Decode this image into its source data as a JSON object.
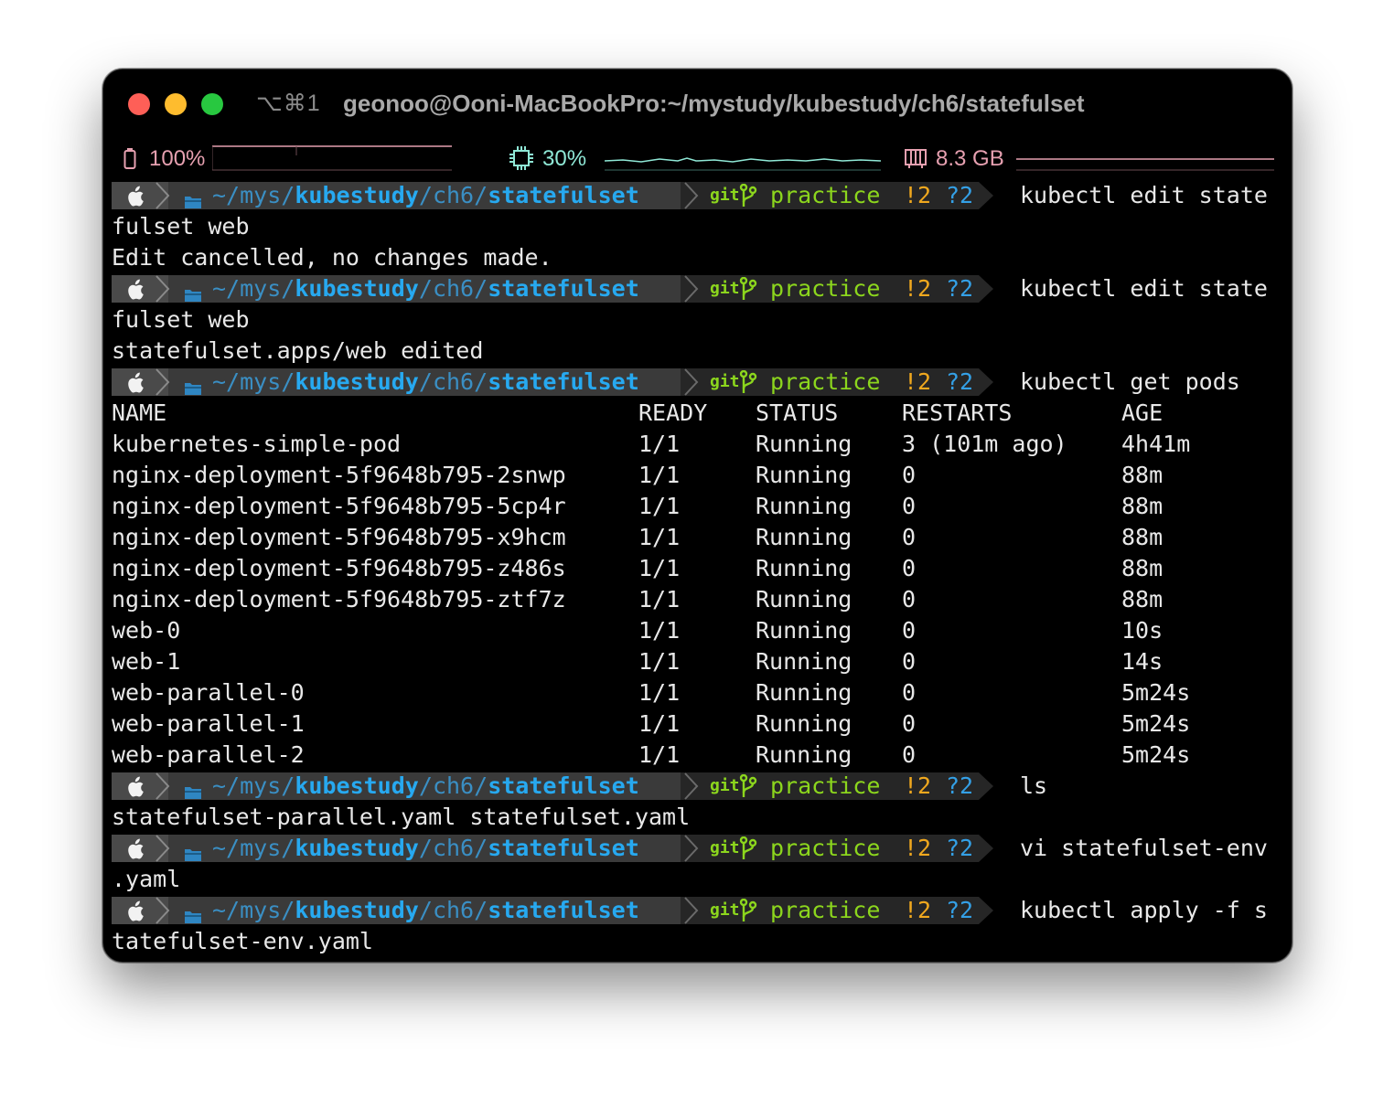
{
  "window": {
    "shortcut": "⌥⌘1",
    "title": "geonoo@Ooni-MacBookPro:~/mystudy/kubestudy/ch6/statefulset"
  },
  "status_bar": {
    "battery": "100%",
    "cpu": "30%",
    "memory": "8.3 GB",
    "colors": {
      "battery": "#e6a0b0",
      "cpu": "#8fe8d6",
      "memory": "#e6a0b0"
    }
  },
  "prompt": {
    "path_home": "~/",
    "path_mys": "mys/",
    "path_kubestudy": "kubestudy",
    "path_ch6": "/ch6/",
    "path_statefulset": "statefulset",
    "git_label": "git",
    "branch": "practice",
    "modified": "!2",
    "untracked": "?2"
  },
  "session": [
    {
      "command": "kubectl edit state",
      "output": [
        "fulset web",
        "Edit cancelled, no changes made."
      ]
    },
    {
      "command": "kubectl edit state",
      "output": [
        "fulset web",
        "statefulset.apps/web edited"
      ]
    },
    {
      "command": "kubectl get pods"
    },
    {
      "command": "ls",
      "output": [
        "statefulset-parallel.yaml statefulset.yaml"
      ]
    },
    {
      "command": "vi statefulset-env",
      "output": [
        ".yaml"
      ]
    },
    {
      "command": "kubectl apply -f s",
      "output": [
        "tatefulset-env.yaml"
      ]
    }
  ],
  "pods_table": {
    "headers": [
      "NAME",
      "READY",
      "STATUS",
      "RESTARTS",
      "AGE"
    ],
    "rows": [
      [
        "kubernetes-simple-pod",
        "1/1",
        "Running",
        "3 (101m ago)",
        "4h41m"
      ],
      [
        "nginx-deployment-5f9648b795-2snwp",
        "1/1",
        "Running",
        "0",
        "88m"
      ],
      [
        "nginx-deployment-5f9648b795-5cp4r",
        "1/1",
        "Running",
        "0",
        "88m"
      ],
      [
        "nginx-deployment-5f9648b795-x9hcm",
        "1/1",
        "Running",
        "0",
        "88m"
      ],
      [
        "nginx-deployment-5f9648b795-z486s",
        "1/1",
        "Running",
        "0",
        "88m"
      ],
      [
        "nginx-deployment-5f9648b795-ztf7z",
        "1/1",
        "Running",
        "0",
        "88m"
      ],
      [
        "web-0",
        "1/1",
        "Running",
        "0",
        "10s"
      ],
      [
        "web-1",
        "1/1",
        "Running",
        "0",
        "14s"
      ],
      [
        "web-parallel-0",
        "1/1",
        "Running",
        "0",
        "5m24s"
      ],
      [
        "web-parallel-1",
        "1/1",
        "Running",
        "0",
        "5m24s"
      ],
      [
        "web-parallel-2",
        "1/1",
        "Running",
        "0",
        "5m24s"
      ]
    ]
  }
}
